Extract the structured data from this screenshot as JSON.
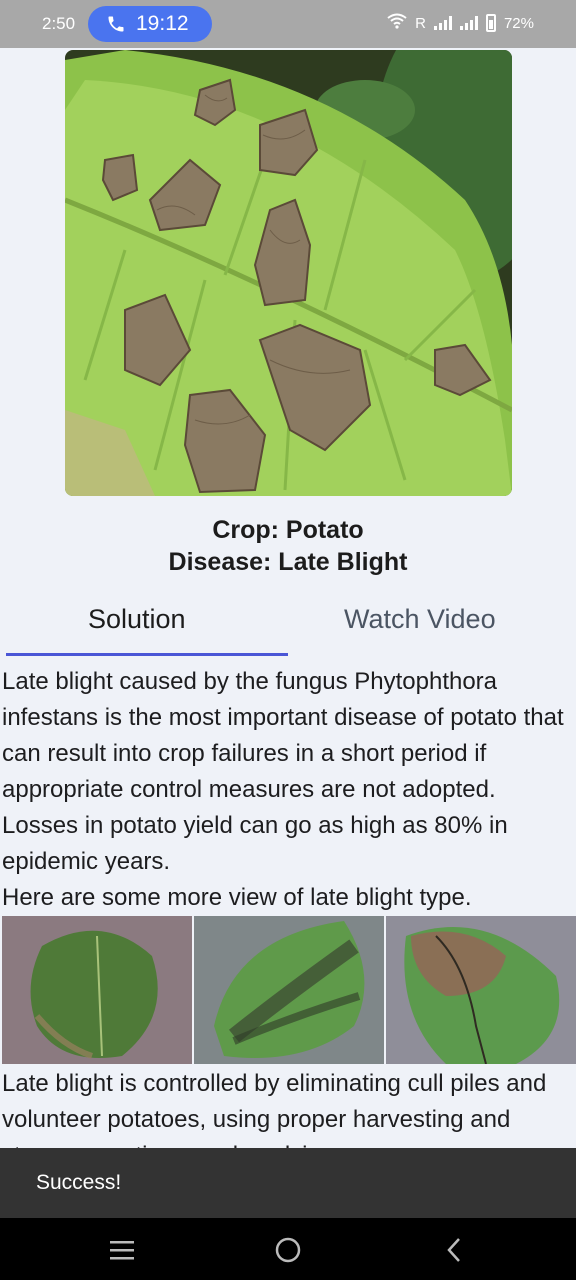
{
  "status_bar": {
    "time": "2:50",
    "call_time": "19:12",
    "network_label": "R",
    "battery": "72%"
  },
  "hero_image": {
    "subject": "potato leaf with late blight lesions"
  },
  "header": {
    "crop_line": "Crop: Potato",
    "disease_line": "Disease: Late Blight"
  },
  "tabs": [
    {
      "label": "Solution",
      "selected": true
    },
    {
      "label": "Watch Video",
      "selected": false
    }
  ],
  "content": {
    "paragraph_1": "Late blight caused by the fungus Phytophthora infestans is the most important disease of potato that can result into crop failures in a short period if appropriate control measures are not adopted. Losses in potato yield can go as high as 80% in epidemic years.",
    "paragraph_2": "Here are some more view of late blight type.",
    "paragraph_3": "Late blight is controlled by eliminating cull piles and volunteer potatoes, using proper harvesting and storage practices, and applying"
  },
  "snackbar": {
    "message": "Success!"
  },
  "nav_bar": {
    "icons": [
      "recents-icon",
      "home-icon",
      "back-icon"
    ]
  },
  "colors": {
    "accent": "#4a56d6",
    "call_pill": "#4a74ef",
    "snackbar": "#333333"
  }
}
